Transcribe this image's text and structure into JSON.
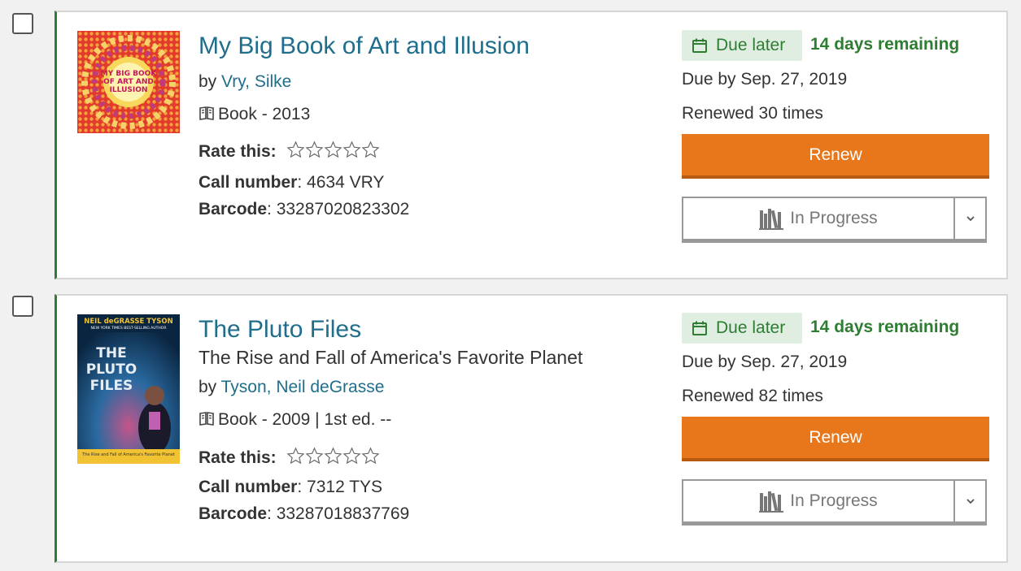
{
  "items": [
    {
      "title": "My Big Book of Art and Illusion",
      "subtitle": "",
      "by_prefix": "by ",
      "author": "Vry, Silke",
      "format": "Book - 2013",
      "rate_label": "Rate this:",
      "call_number_label": "Call number",
      "call_number": ": 4634 VRY",
      "barcode_label": "Barcode",
      "barcode": ": 33287020823302",
      "due_status": "Due later",
      "remaining": "14 days remaining",
      "due_by": "Due by Sep. 27, 2019",
      "renewed": "Renewed 30 times",
      "renew_label": "Renew",
      "shelf_label": "In Progress",
      "cover_text": "MY BIG BOOK OF ART AND ILLUSION"
    },
    {
      "title": "The Pluto Files",
      "subtitle": "The Rise and Fall of America's Favorite Planet",
      "by_prefix": "by ",
      "author": "Tyson, Neil deGrasse",
      "format": "Book - 2009 | 1st ed. --",
      "rate_label": "Rate this:",
      "call_number_label": "Call number",
      "call_number": ": 7312 TYS",
      "barcode_label": "Barcode",
      "barcode": ": 33287018837769",
      "due_status": "Due later",
      "remaining": "14 days remaining",
      "due_by": "Due by Sep. 27, 2019",
      "renewed": "Renewed 82 times",
      "renew_label": "Renew",
      "shelf_label": "In Progress",
      "cover_author": "NEIL deGRASSE TYSON",
      "cover_tagline": "NEW YORK TIMES BEST-SELLING AUTHOR",
      "cover_title": "THE PLUTO FILES",
      "cover_subtitle": "The Rise and Fall of America's Favorite Planet"
    }
  ],
  "colors": {
    "accent_green": "#2e7d32",
    "link_blue": "#1f6e8c",
    "renew_orange": "#e8761a"
  }
}
